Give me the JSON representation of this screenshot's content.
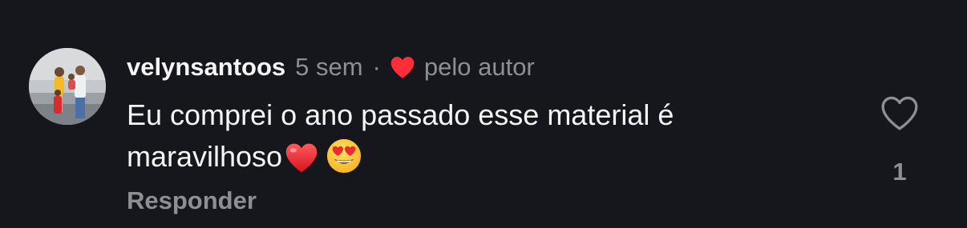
{
  "comment": {
    "avatar_alt": "avatar",
    "username": "velynsantoos",
    "time": "5 sem",
    "separator": "·",
    "liked_by_author_label": "pelo autor",
    "text": "Eu comprei o ano passado esse material é maravilhoso",
    "emojis": [
      "red-heart-emoji",
      "heart-eyes-emoji"
    ],
    "reply_label": "Responder",
    "like_count": "1"
  },
  "colors": {
    "background": "#16171c",
    "primary_text": "#f5f5f5",
    "secondary_text": "#8e8f93",
    "heart_red": "#ff2d3a"
  }
}
